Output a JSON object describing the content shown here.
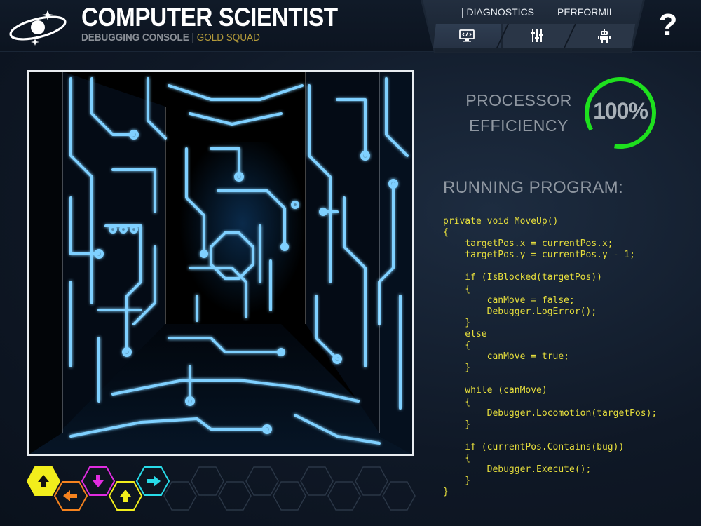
{
  "header": {
    "title": "COMPUTER SCIENTIST",
    "subtitle_console": "DEBUGGING CONSOLE",
    "subtitle_separator": "|",
    "subtitle_squad": "GOLD SQUAD",
    "logo_icon": "orbit-logo-icon"
  },
  "tabs": {
    "diagnostics": "| DIAGNOSTICS",
    "performing": "PERFORMING S",
    "icons": [
      "code-monitor-icon",
      "sliders-icon",
      "robot-icon"
    ]
  },
  "help": {
    "label": "?"
  },
  "processor": {
    "label_line1": "PROCESSOR",
    "label_line2": "EFFICIENCY",
    "value": "100%",
    "efficiency_fraction": 1.0,
    "color": "#1ee01e"
  },
  "program": {
    "title": "RUNNING PROGRAM:",
    "code_lines": [
      "private void MoveUp()",
      "{",
      "    targetPos.x = currentPos.x;",
      "    targetPos.y = currentPos.y - 1;",
      "",
      "    if (IsBlocked(targetPos))",
      "    {",
      "        canMove = false;",
      "        Debugger.LogError();",
      "    }",
      "    else",
      "    {",
      "        canMove = true;",
      "    }",
      "",
      "    while (canMove)",
      "    {",
      "        Debugger.Locomotion(targetPos);",
      "    }",
      "",
      "    if (currentPos.Contains(bug))",
      "    {",
      "        Debugger.Execute();",
      "    }",
      "}"
    ],
    "code_color": "#e6de3c"
  },
  "commands": [
    {
      "icon": "arrow-up-icon",
      "color": "#f2ee1c",
      "filled": true
    },
    {
      "icon": "arrow-left-icon",
      "color": "#f5821e",
      "filled": false
    },
    {
      "icon": "arrow-down-icon",
      "color": "#e02ce0",
      "filled": false
    },
    {
      "icon": "arrow-up-icon",
      "color": "#f2ee1c",
      "filled": false
    },
    {
      "icon": "arrow-right-icon",
      "color": "#28dbe8",
      "filled": false
    }
  ],
  "empty_slot_count": 9
}
